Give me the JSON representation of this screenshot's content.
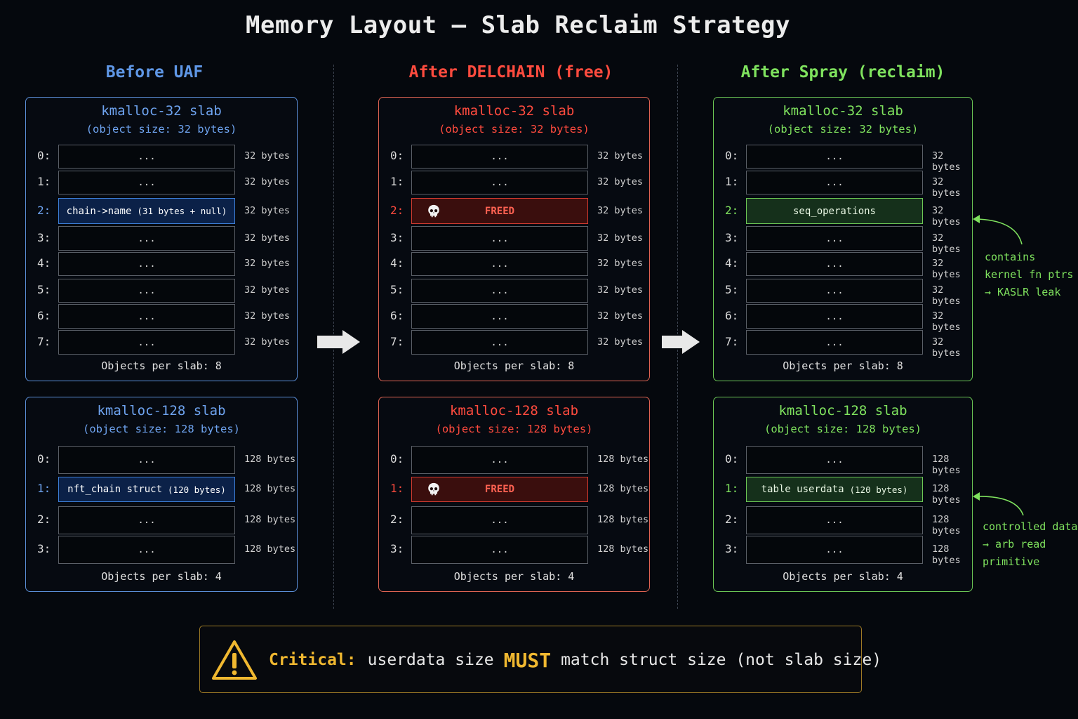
{
  "title": "Memory Layout — Slab Reclaim Strategy",
  "colors": {
    "before": "#5f97e6",
    "after_free": "#ff4b3e",
    "after_spray": "#7fe25e",
    "critical": "#f0b830"
  },
  "columns": [
    {
      "heading": "Before UAF",
      "theme": "blue",
      "slabs": [
        {
          "title": "kmalloc-32 slab",
          "subtitle": "(object size: 32 bytes)",
          "footer": "Objects per slab: 8",
          "slots": [
            {
              "index": "0:",
              "label": "...",
              "size": "32 bytes"
            },
            {
              "index": "1:",
              "label": "...",
              "size": "32 bytes"
            },
            {
              "index": "2:",
              "label": "chain->name",
              "note": "(31 bytes + null)",
              "size": "32 bytes",
              "highlight": true
            },
            {
              "index": "3:",
              "label": "...",
              "size": "32 bytes"
            },
            {
              "index": "4:",
              "label": "...",
              "size": "32 bytes"
            },
            {
              "index": "5:",
              "label": "...",
              "size": "32 bytes"
            },
            {
              "index": "6:",
              "label": "...",
              "size": "32 bytes"
            },
            {
              "index": "7:",
              "label": "...",
              "size": "32 bytes"
            }
          ]
        },
        {
          "title": "kmalloc-128 slab",
          "subtitle": "(object size: 128 bytes)",
          "footer": "Objects per slab: 4",
          "slots": [
            {
              "index": "0:",
              "label": "...",
              "size": "128 bytes"
            },
            {
              "index": "1:",
              "label": "nft_chain struct",
              "note": "(120 bytes)",
              "size": "128 bytes",
              "highlight": true
            },
            {
              "index": "2:",
              "label": "...",
              "size": "128 bytes"
            },
            {
              "index": "3:",
              "label": "...",
              "size": "128 bytes"
            }
          ]
        }
      ]
    },
    {
      "heading": "After DELCHAIN (free)",
      "theme": "red",
      "slabs": [
        {
          "title": "kmalloc-32 slab",
          "subtitle": "(object size: 32 bytes)",
          "footer": "Objects per slab: 8",
          "slots": [
            {
              "index": "0:",
              "label": "...",
              "size": "32 bytes"
            },
            {
              "index": "1:",
              "label": "...",
              "size": "32 bytes"
            },
            {
              "index": "2:",
              "label": "FREED",
              "size": "32 bytes",
              "highlight": true,
              "icon": "skull-icon"
            },
            {
              "index": "3:",
              "label": "...",
              "size": "32 bytes"
            },
            {
              "index": "4:",
              "label": "...",
              "size": "32 bytes"
            },
            {
              "index": "5:",
              "label": "...",
              "size": "32 bytes"
            },
            {
              "index": "6:",
              "label": "...",
              "size": "32 bytes"
            },
            {
              "index": "7:",
              "label": "...",
              "size": "32 bytes"
            }
          ]
        },
        {
          "title": "kmalloc-128 slab",
          "subtitle": "(object size: 128 bytes)",
          "footer": "Objects per slab: 4",
          "slots": [
            {
              "index": "0:",
              "label": "...",
              "size": "128 bytes"
            },
            {
              "index": "1:",
              "label": "FREED",
              "size": "128 bytes",
              "highlight": true,
              "icon": "skull-icon"
            },
            {
              "index": "2:",
              "label": "...",
              "size": "128 bytes"
            },
            {
              "index": "3:",
              "label": "...",
              "size": "128 bytes"
            }
          ]
        }
      ]
    },
    {
      "heading": "After Spray (reclaim)",
      "theme": "green",
      "slabs": [
        {
          "title": "kmalloc-32 slab",
          "subtitle": "(object size: 32 bytes)",
          "footer": "Objects per slab: 8",
          "slots": [
            {
              "index": "0:",
              "label": "...",
              "size": "32 bytes"
            },
            {
              "index": "1:",
              "label": "...",
              "size": "32 bytes"
            },
            {
              "index": "2:",
              "label": "seq_operations",
              "size": "32 bytes",
              "highlight": true
            },
            {
              "index": "3:",
              "label": "...",
              "size": "32 bytes"
            },
            {
              "index": "4:",
              "label": "...",
              "size": "32 bytes"
            },
            {
              "index": "5:",
              "label": "...",
              "size": "32 bytes"
            },
            {
              "index": "6:",
              "label": "...",
              "size": "32 bytes"
            },
            {
              "index": "7:",
              "label": "...",
              "size": "32 bytes"
            }
          ]
        },
        {
          "title": "kmalloc-128 slab",
          "subtitle": "(object size: 128 bytes)",
          "footer": "Objects per slab: 4",
          "slots": [
            {
              "index": "0:",
              "label": "...",
              "size": "128 bytes"
            },
            {
              "index": "1:",
              "label": "table userdata",
              "note": "(120 bytes)",
              "size": "128 bytes",
              "highlight": true
            },
            {
              "index": "2:",
              "label": "...",
              "size": "128 bytes"
            },
            {
              "index": "3:",
              "label": "...",
              "size": "128 bytes"
            }
          ]
        }
      ]
    }
  ],
  "annotations": {
    "seq_operations": [
      "contains",
      "kernel fn ptrs",
      "→ KASLR leak"
    ],
    "table_userdata": [
      "controlled data",
      "→ arb read",
      "primitive"
    ]
  },
  "critical": {
    "label": "Critical:",
    "text_before": "userdata size",
    "emphasis": "MUST",
    "text_after": "match struct size (not slab size)"
  }
}
